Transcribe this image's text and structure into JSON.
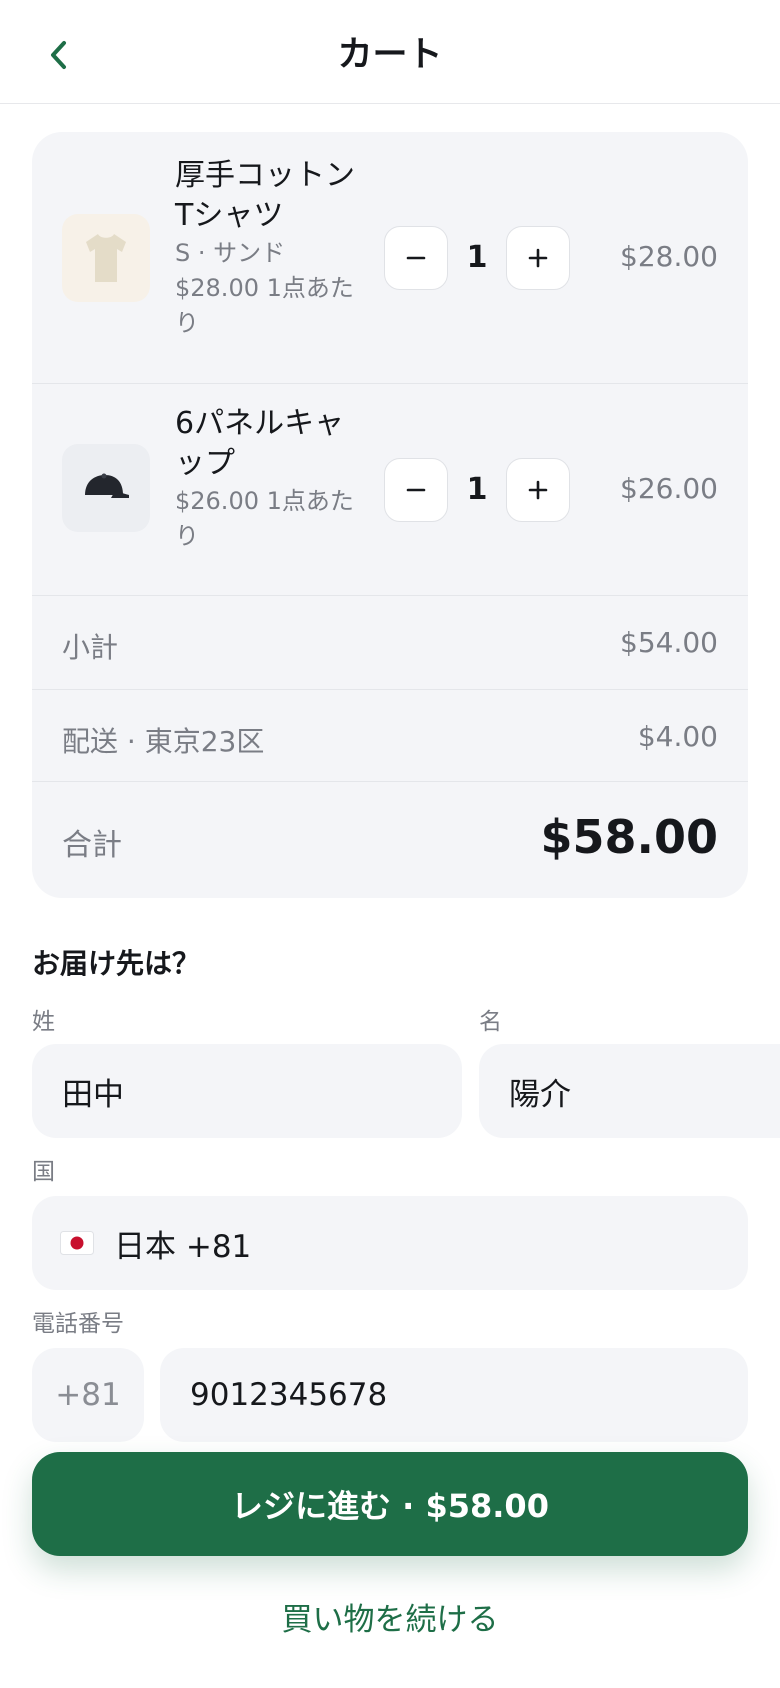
{
  "header": {
    "title": "カート",
    "back_icon": "chevron-left-icon"
  },
  "cart": {
    "items": [
      {
        "name": "厚手コットンTシャツ",
        "variant": "S · サンド",
        "unit_price": "$28.00 1点あたり",
        "quantity": "1",
        "line_total": "$28.00",
        "thumb_icon": "tshirt-icon",
        "thumb_color": "#e4dcc8"
      },
      {
        "name": "6パネルキャップ",
        "unit_price": "$26.00 1点あたり",
        "quantity": "1",
        "line_total": "$26.00",
        "thumb_icon": "cap-icon",
        "thumb_color": "#23262d"
      }
    ],
    "decrement_icon": "minus-icon",
    "increment_icon": "plus-icon",
    "subtotal": {
      "label": "小計",
      "value": "$54.00"
    },
    "shipping": {
      "label": "配送 · 東京23区",
      "value": "$4.00"
    },
    "total": {
      "label": "合計",
      "value": "$58.00"
    }
  },
  "form": {
    "title": "お届け先は？",
    "last_name": {
      "label": "姓",
      "value": "田中"
    },
    "first_name": {
      "label": "名",
      "value": "陽介"
    },
    "country": {
      "label": "国",
      "value": "日本 +81",
      "flag_icon": "japan-flag-icon"
    },
    "phone": {
      "label": "電話番号",
      "prefix": "+81",
      "value": "9012345678"
    }
  },
  "actions": {
    "checkout_label": "レジに進む · $58.00",
    "continue_label": "買い物を続ける"
  },
  "colors": {
    "accent": "#1e6e47",
    "card_bg": "#f4f5f8",
    "muted_text": "#7a7d85"
  }
}
